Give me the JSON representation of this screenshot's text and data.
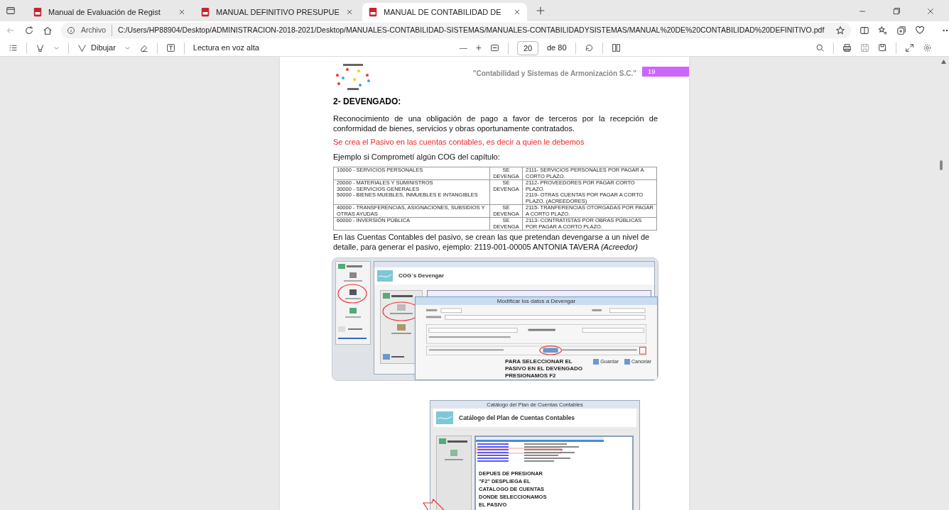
{
  "tabs": [
    {
      "title": "Manual de Evaluación de Regist",
      "selected": false
    },
    {
      "title": "MANUAL DEFINITIVO PRESUPUE",
      "selected": false
    },
    {
      "title": "MANUAL DE CONTABILIDAD DE",
      "selected": true
    }
  ],
  "address_bar": {
    "scheme_label": "Archivo",
    "url": "C:/Users/HP88904/Desktop/ADMINISTRACION-2018-2021/Desktop/MANUALES-CONTABILIDAD-SISTEMAS/MANUALES-CONTABILIDADYSISTEMAS/MANUAL%20DE%20CONTABILIDAD%20DEFINITIVO.pdf"
  },
  "pdf_toolbar": {
    "draw_label": "Dibujar",
    "read_aloud_label": "Lectura en voz alta",
    "zoom_out": "—",
    "zoom_in": "+",
    "page": "20",
    "page_count": "de 80"
  },
  "document": {
    "header": "\"Contabilidad y Sistemas de Armonización S.C.\"",
    "page_number": "19",
    "heading": "2- DEVENGADO:",
    "paragraph": "Reconocimiento de una obligación de pago a favor de terceros por la recepción de conformidad de bienes, servicios y obras oportunamente contratados.",
    "highlight": "Se crea el Pasivo en las cuentas contables, es decir a quien le debemos",
    "example_intro": "Ejemplo si Comprometí algún COG del capítulo:",
    "table": {
      "rows": [
        [
          "10000 - SERVICIOS PERSONALES",
          "SE DEVENGA",
          "2111- SERVICIOS PERSONALES POR PAGAR A CORTO PLAZO."
        ],
        [
          "20000 - MATERIALES Y SUMINISTROS\n30000 - SERVICIOS GENERALES\n50000 - BIENES MUEBLES, INMUEBLES E INTANGIBLES",
          "SE DEVENGA",
          "2112- PROVEEDORES POR PAGAR CORTO PLAZO.\n2119- OTRAS CUENTAS POR PAGAR A CORTO PLAZO. (ACREEDORES)"
        ],
        [
          "40000 - TRANSFERENCIAS, ASIGNACIONES, SUBSIDIOS Y OTRAS AYUDAS",
          "SE DEVENGA",
          "2115- TRANFERENCIAS OTORGADAS POR PAGAR A CORTO PLAZO."
        ],
        [
          "60000 - INVERSIÓN PÚBLICA",
          "SE DEVENGA",
          "2113- CONTRATISTAS POR OBRAS PÚBLICAS POR PAGAR A CORTO PLAZO."
        ]
      ]
    },
    "note": "En las Cuentas Contables del pasivo, se crean las que pretendan devengarse a un nivel de detalle, para generar el pasivo, ejemplo: 2119-001-00005 ANTONIA TAVERA *(Acreedor)*",
    "screenshot_1": {
      "header": "COG´s Devengar",
      "dialog": {
        "title": "Modificar los datos a Devengar",
        "caption": "PARA SELECCIONAR EL PASIVO EN EL DEVENGADO PRESIONAMOS F2",
        "buttons": [
          "Guardar",
          "Cancelar"
        ]
      }
    },
    "screenshot_2": {
      "window_title": "Catálogo del Plan de Cuentas Contables",
      "header": "Catálogo del Plan de Cuentas Contables",
      "caption": "DEPUES DE PRESIONAR \"F2\" DESPLIEGA EL CATALOGO DE CUENTAS DONDE SELECCIONAMOS EL PASIVO"
    }
  }
}
